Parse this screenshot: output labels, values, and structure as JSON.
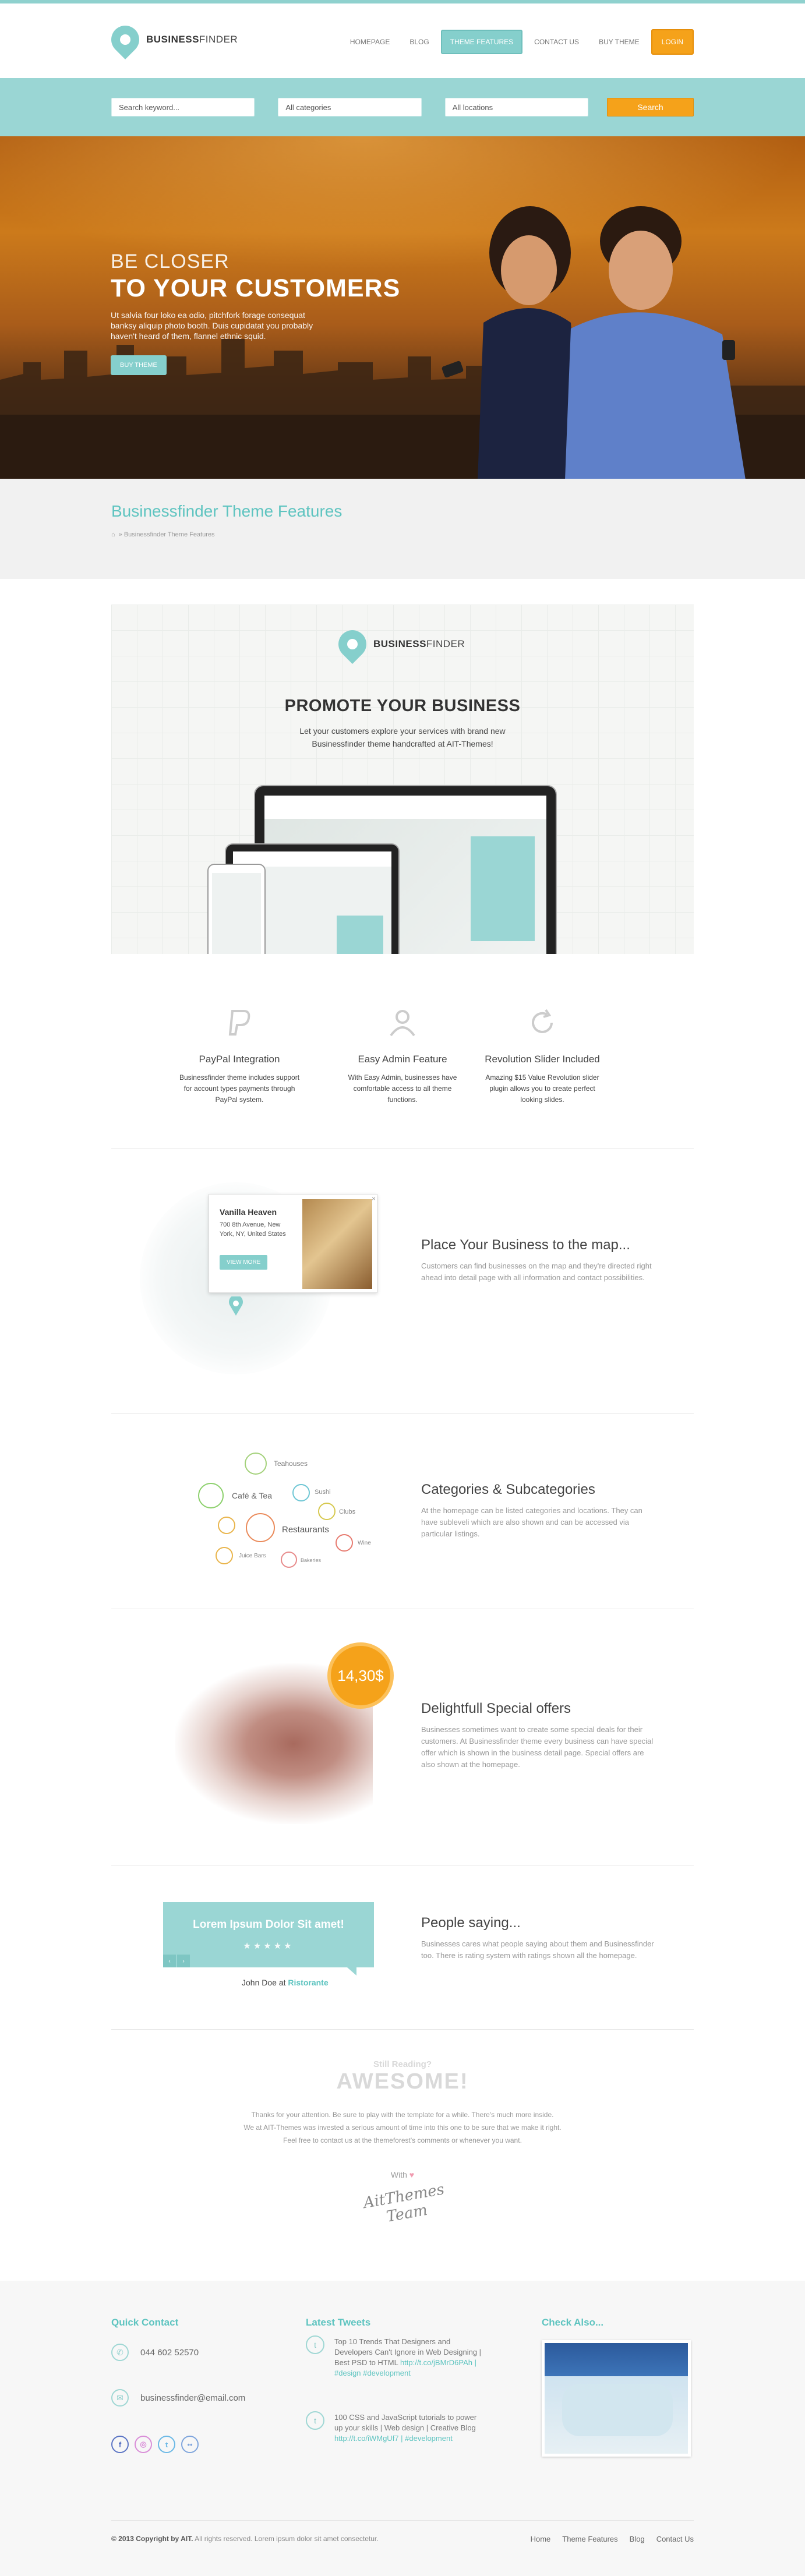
{
  "brand": {
    "name_bold": "BUSINESS",
    "name_light": "FINDER"
  },
  "nav": {
    "items": [
      "HOMEPAGE",
      "BLOG",
      "THEME FEATURES",
      "CONTACT US",
      "BUY THEME"
    ],
    "active": "THEME FEATURES",
    "login": "LOGIN"
  },
  "search": {
    "keyword_placeholder": "Search keyword...",
    "categories_value": "All categories",
    "locations_value": "All locations",
    "button": "Search"
  },
  "hero": {
    "line1": "BE CLOSER",
    "line2": "TO YOUR CUSTOMERS",
    "text": "Ut salvia four loko ea odio, pitchfork forage consequat banksy aliquip photo booth. Duis cupidatat you probably haven't heard of them, flannel ethnic squid.",
    "button": "BUY THEME"
  },
  "page": {
    "title": "Businessfinder Theme Features",
    "breadcrumb_home": "⌂",
    "breadcrumb_current": "» Businessfinder Theme Features"
  },
  "promo": {
    "title": "PROMOTE YOUR BUSINESS",
    "text": "Let your customers explore your services with brand new Businessfinder theme handcrafted at AIT-Themes!"
  },
  "features": [
    {
      "title": "PayPal Integration",
      "text": "Businessfinder theme includes support for account types payments through PayPal system.",
      "icon": "paypal-icon"
    },
    {
      "title": "Easy Admin Feature",
      "text": "With Easy Admin, businesses have comfortable access to all theme functions.",
      "icon": "admin-icon"
    },
    {
      "title": "Revolution Slider Included",
      "text": "Amazing $15 Value Revolution slider plugin allows you to create perfect looking slides.",
      "icon": "refresh-icon"
    }
  ],
  "map_section": {
    "title": "Place Your Business to the map...",
    "text": "Customers can find businesses on the map and they're directed right ahead into detail page with all information and contact possibilities.",
    "popup_title": "Vanilla Heaven",
    "popup_address": "700 8th Avenue, New York, NY, United States",
    "popup_button": "VIEW MORE"
  },
  "categories_section": {
    "title": "Categories & Subcategories",
    "text": "At the homepage can be listed categories and locations. They can have subleveli which are also shown and can be accessed via particular listings.",
    "labels": [
      "Teahouses",
      "Café & Tea",
      "Sushi",
      "Clubs",
      "Restaurants",
      "Juice Bars",
      "Wine",
      "Bakeries"
    ]
  },
  "offers_section": {
    "title": "Delightfull Special offers",
    "text": "Businesses sometimes want to create some special deals for their customers. At Businessfinder theme every business can have special offer which is shown in the business detail page. Special offers are also shown at the homepage.",
    "price": "14,30$"
  },
  "people_section": {
    "title": "People saying...",
    "text": "Businesses cares what people saying about them and Businessfinder too. There is rating system with ratings shown all the homepage.",
    "quote": "Lorem Ipsum Dolor Sit amet!",
    "stars": "★★★★★",
    "author": "John Doe at ",
    "author_place": "Ristorante"
  },
  "awesome": {
    "pre": "Still Reading?",
    "title": "AWESOME!",
    "lines": [
      "Thanks for your attention. Be sure to play with the template for a while. There's much more inside.",
      "We at AIT-Themes was invested a serious amount of time into this one to be sure that we make it right.",
      "Feel free to contact us at the themeforest's comments or whenever you want."
    ],
    "with": "With",
    "heart": "♥",
    "signature": "AitThemes Team"
  },
  "footer": {
    "quick_contact": "Quick Contact",
    "phone": "044 602 52570",
    "email": "businessfinder@email.com",
    "latest_tweets": "Latest Tweets",
    "tweet1": "Top 10 Trends That Designers and Developers Can't Ignore in Web Designing | Best PSD to HTML ",
    "tweet1_link": "http://t.co/jBMrD6PAh",
    "tweet1_tags": " | #design #development",
    "tweet2": "100 CSS and JavaScript tutorials to power up your skills | Web design | Creative Blog ",
    "tweet2_link": "http://t.co/iWMgUf7",
    "tweet2_tags": " | #development",
    "check_also": "Check Also...",
    "copyright_bold": "© 2013 Copyright by AIT.",
    "copyright_rest": " All rights reserved. Lorem ipsum dolor sit amet consectetur.",
    "links": [
      "Home",
      "Theme Features",
      "Blog",
      "Contact Us"
    ]
  },
  "colors": {
    "accent": "#85cfcc",
    "orange": "#f5a21a",
    "title": "#5ec4c0"
  }
}
